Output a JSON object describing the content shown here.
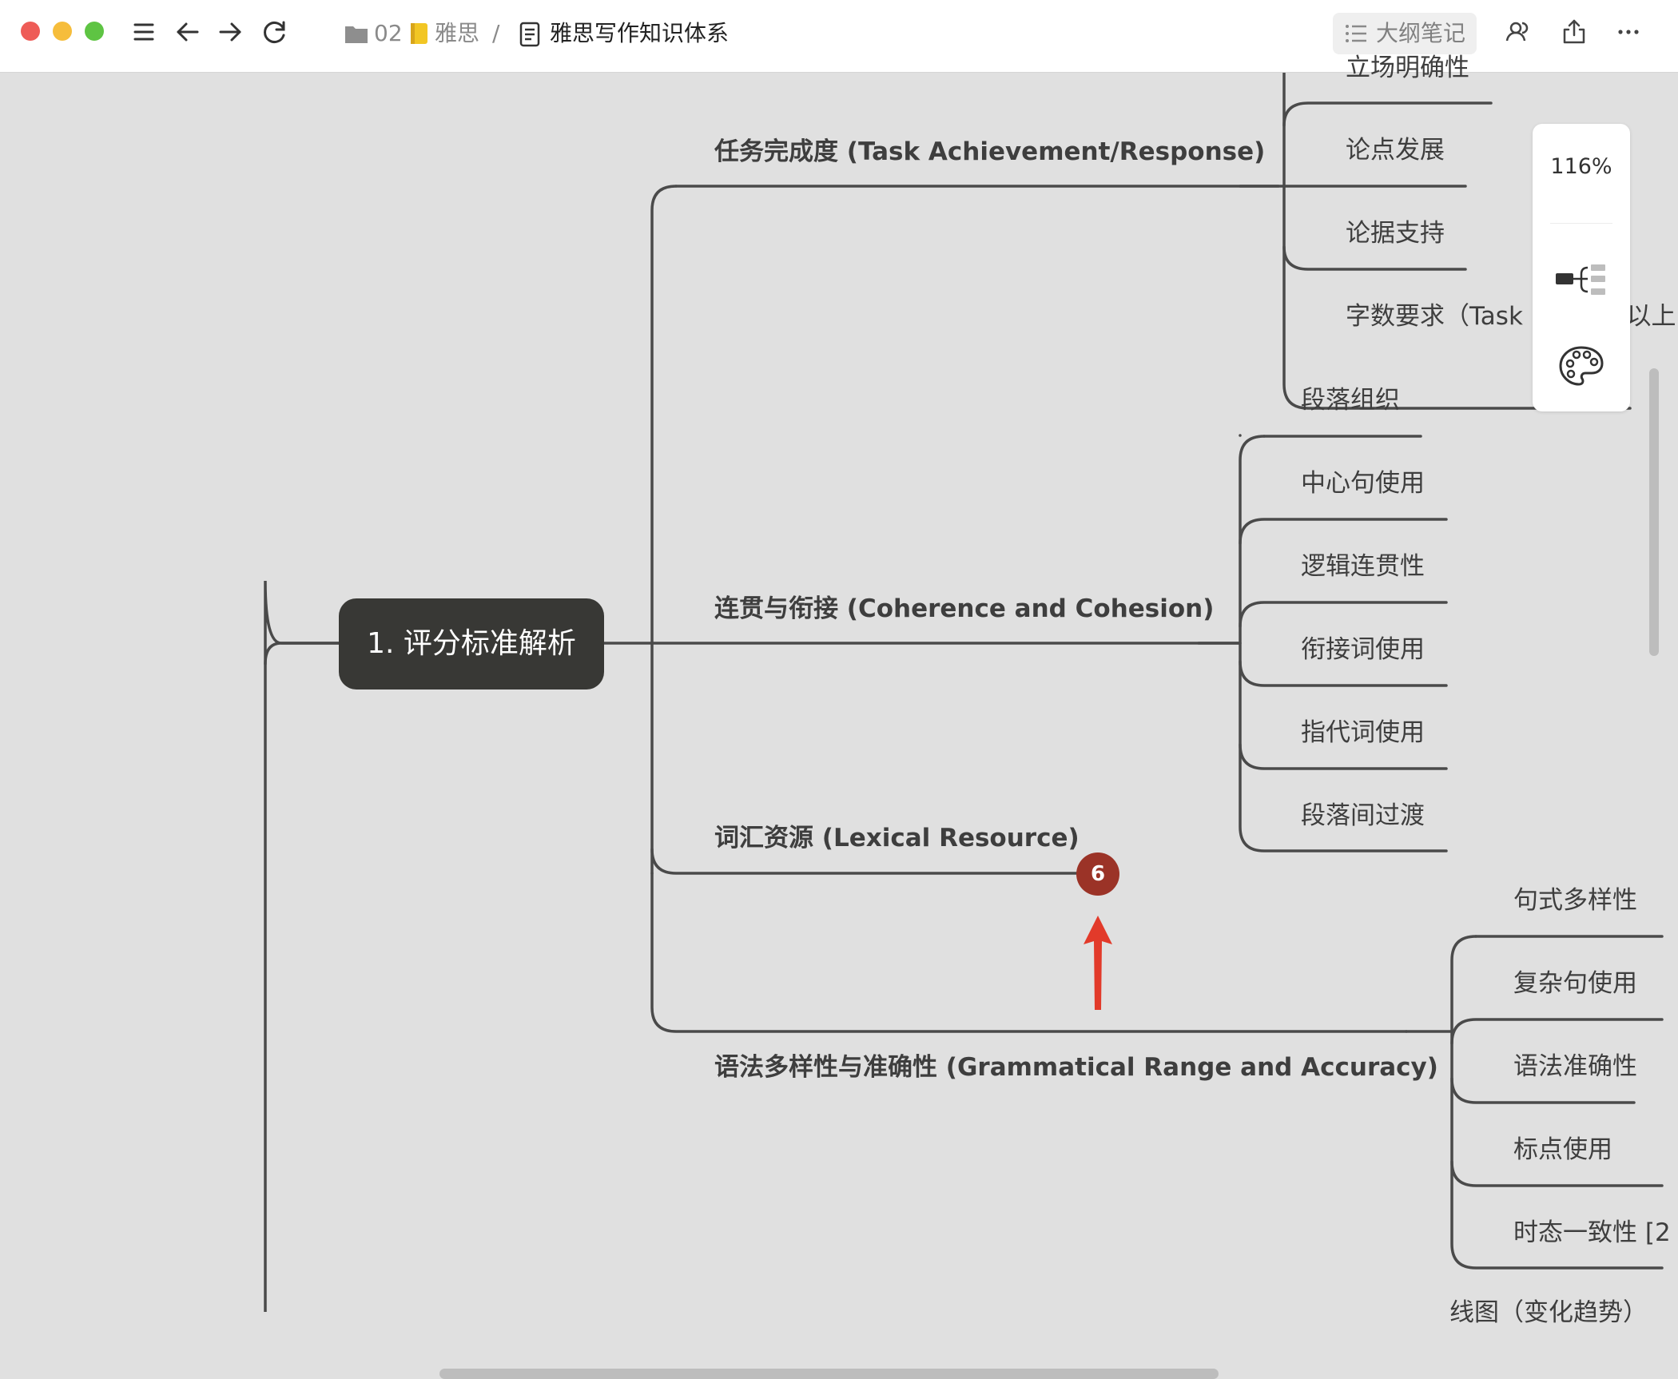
{
  "toolbar": {
    "breadcrumb_folder": "02",
    "breadcrumb_notebook": "雅思",
    "separator": "/",
    "doc_title": "雅思写作知识体系",
    "outline_button": "大纲笔记",
    "icons": [
      "menu-icon",
      "back-arrow-icon",
      "forward-arrow-icon",
      "refresh-icon",
      "folder-icon",
      "notebook-icon",
      "document-icon",
      "outline-list-icon",
      "collaborators-icon",
      "share-icon",
      "more-icon"
    ],
    "traffic_lights": {
      "close": "#ee5c57",
      "minimize": "#f6bd3b",
      "maximize": "#5ec443"
    }
  },
  "mindmap": {
    "root": "1. 评分标准解析",
    "task": {
      "title": "任务完成度 (Task Achievement/Response)",
      "children": [
        "立场明确性",
        "论点发展",
        "论据支持",
        "字数要求（Task 1 150词以上"
      ]
    },
    "coherence": {
      "title": "连贯与衔接 (Coherence and Cohesion)",
      "children": [
        "段落组织",
        "中心句使用",
        "逻辑连贯性",
        "衔接词使用",
        "指代词使用",
        "段落间过渡"
      ]
    },
    "lexical": {
      "title": "词汇资源 (Lexical Resource)",
      "collapsed_count": "6"
    },
    "grammar": {
      "title": "语法多样性与准确性 (Grammatical Range and Accuracy)",
      "children": [
        "句式多样性",
        "复杂句使用",
        "语法准确性",
        "标点使用",
        "时态一致性 [2"
      ]
    },
    "next_branch": "线图（变化趋势）",
    "line_color": "#4a4a4a",
    "arrow_color": "#e23a2a"
  },
  "side_panel": {
    "zoom": "116%",
    "icons": [
      "structure-icon",
      "palette-icon"
    ]
  }
}
